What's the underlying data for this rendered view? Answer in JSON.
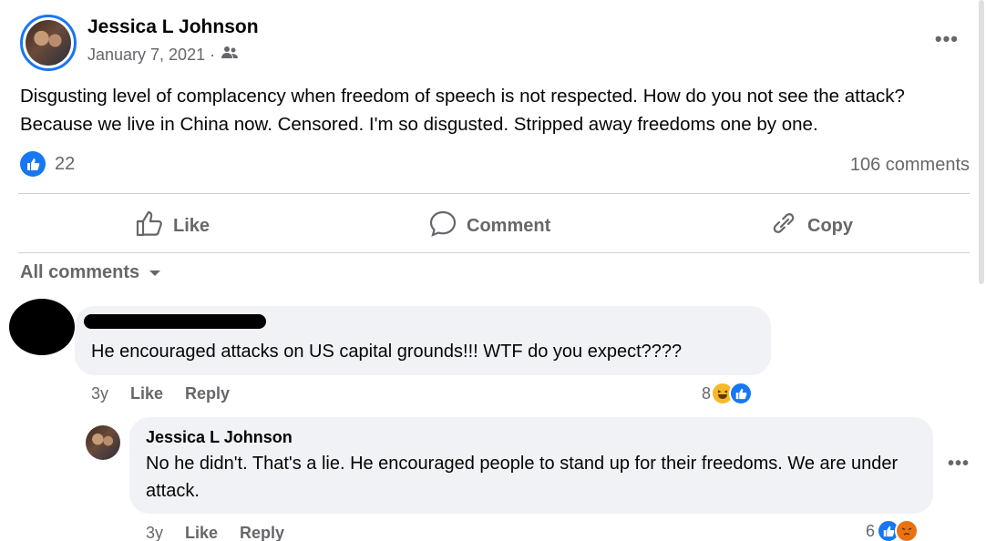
{
  "post": {
    "author": "Jessica L Johnson",
    "date": "January 7, 2021 ·",
    "audience_icon": "friends-icon",
    "text": "Disgusting level of complacency when freedom of speech is not respected. How do you not see the attack? Because we live in China now. Censored. I'm so disgusted. Stripped away freedoms one by one.",
    "likes": "22",
    "comments": "106 comments"
  },
  "actions": {
    "like": "Like",
    "comment": "Comment",
    "copy": "Copy"
  },
  "filter": {
    "label": "All comments"
  },
  "comment1": {
    "text": "He encouraged attacks on US capital grounds!!! WTF do you expect????",
    "time": "3y",
    "like": "Like",
    "reply": "Reply",
    "reaction_count": "8"
  },
  "comment2": {
    "author": "Jessica L Johnson",
    "text": "No he didn't. That's a lie. He encouraged people to stand up for their freedoms. We are under attack.",
    "time": "3y",
    "like": "Like",
    "reply": "Reply",
    "reaction_count": "6"
  },
  "colors": {
    "accent": "#1877f2",
    "muted_text": "#65676b",
    "bubble": "#f0f2f5"
  }
}
